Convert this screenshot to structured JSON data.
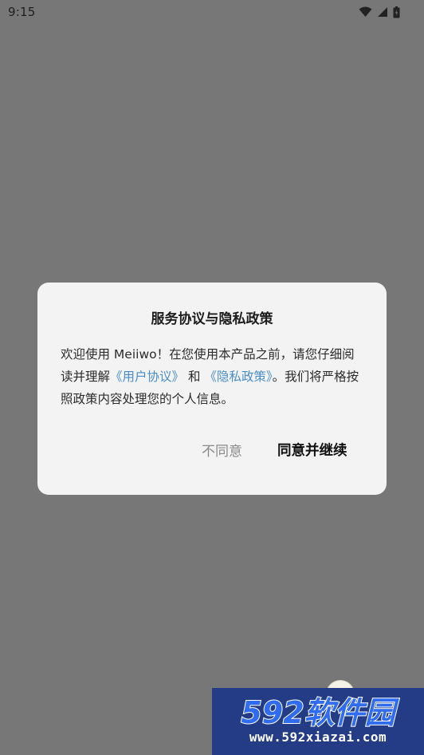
{
  "status_bar": {
    "time": "9:15",
    "icons": [
      "wifi-icon",
      "signal-icon",
      "battery-icon"
    ]
  },
  "dialog": {
    "title": "服务协议与隐私政策",
    "body": {
      "part1": "欢迎使用 Meiiwo！在您使用本产品之前，请您仔细阅读并理解",
      "link1": "《用户协议》",
      "part2": " 和 ",
      "link2": "《隐私政策》",
      "part3": "。我们将严格按照政策内容处理您的个人信息。"
    },
    "buttons": {
      "disagree": "不同意",
      "agree": "同意并继续"
    }
  },
  "colors": {
    "overlay": "#777777",
    "dialog_bg": "#f3f3f3",
    "link": "#4a8ec8",
    "watermark_bg": "#243b86"
  },
  "watermark": {
    "logo_text": "592软件园",
    "site": "www.592xiazai.com"
  }
}
